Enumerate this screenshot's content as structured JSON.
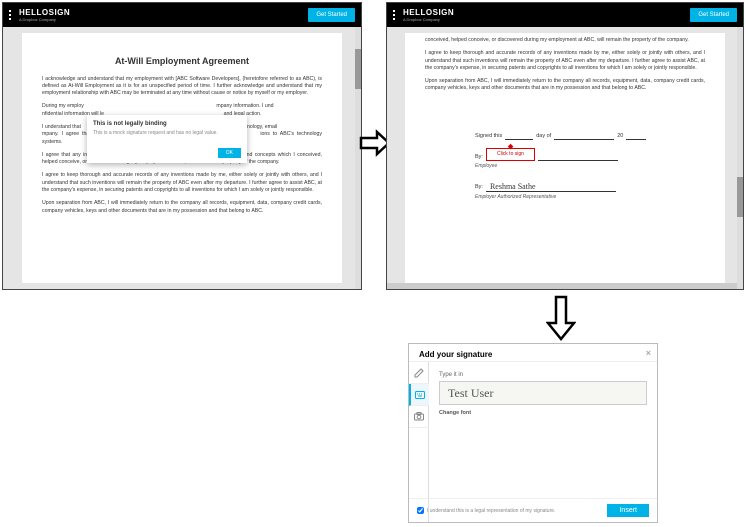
{
  "brand": {
    "name": "HELLOSIGN",
    "tagline": "A Dropbox Company"
  },
  "cta": {
    "get_started": "Get Started"
  },
  "document": {
    "title": "At-Will Employment Agreement",
    "p1": "I acknowledge and understand that my employment with [ABC Software Developers], (heretofore referred to as ABC), is defined as At-Will Employment as it is for an unspecified period of time. I further acknowledge and understand that my employment relationship with ABC may be terminated at any time without cause or notice by myself or my employer.",
    "p2a": "During my employ",
    "p2b": "mpany information. I und",
    "p2c": "nfidential information will le",
    "p2d": "and legal action.",
    "p3a": "I understand that",
    "p3b": "puter technology, email",
    "p3c": "mpany. I agree that I am not perm",
    "p3d": "ions to ABC's technology systems.",
    "p4": "I agree that any inventions, publications, developments, designs, trademarks, ideas and concepts which I conceived, helped conceive, or discovered during my employment at ABC, will remain the property of the company.",
    "p5": "I agree to keep thorough and accurate records of any inventions made by me, either solely or jointly with others, and I understand that such inventions will remain the property of ABC even after my departure. I further agree to assist ABC, at the company's expense, in securing patents and copyrights to all inventions for which I am solely or jointly responsible.",
    "p6": "Upon separation from ABC, I will immediately return to the company all records, equipment, data, company credit cards, company vehicles, keys and other documents that are in my possession and that belong to ABC."
  },
  "modal": {
    "title": "This is not legally binding",
    "body": "This is a mock signature request and has no legal value.",
    "ok": "OK"
  },
  "panel2": {
    "p4": "conceived, helped conceive, or discovered during my employment at ABC, will remain the property of the company.",
    "p5": "I agree to keep thorough and accurate records of any inventions made by me, either solely or jointly with others, and I understand that such inventions will remain the property of ABC even after my departure. I further agree to assist ABC, at the company's expense, in securing patents and copyrights to all inventions for which I am solely or jointly responsible.",
    "p6": "Upon separation from ABC, I will immediately return to the company all records, equipment, data, company credit cards, company vehicles, keys and other documents that are in my possession and that belong to ABC.",
    "signed_this": "Signed this",
    "day_of": "day of",
    "year_prefix": "20",
    "by": "By:",
    "click_to_sign": "Click to sign",
    "employee": "Employee",
    "rep_name": "Reshma Sathe",
    "rep_caption": "Employer Authorized Representative"
  },
  "sig_panel": {
    "title": "Add your signature",
    "type_label": "Type it in",
    "typed_value": "Test User",
    "change_font": "Change font",
    "disclaimer": "I understand this is a legal representation of my signature.",
    "insert": "Insert"
  }
}
